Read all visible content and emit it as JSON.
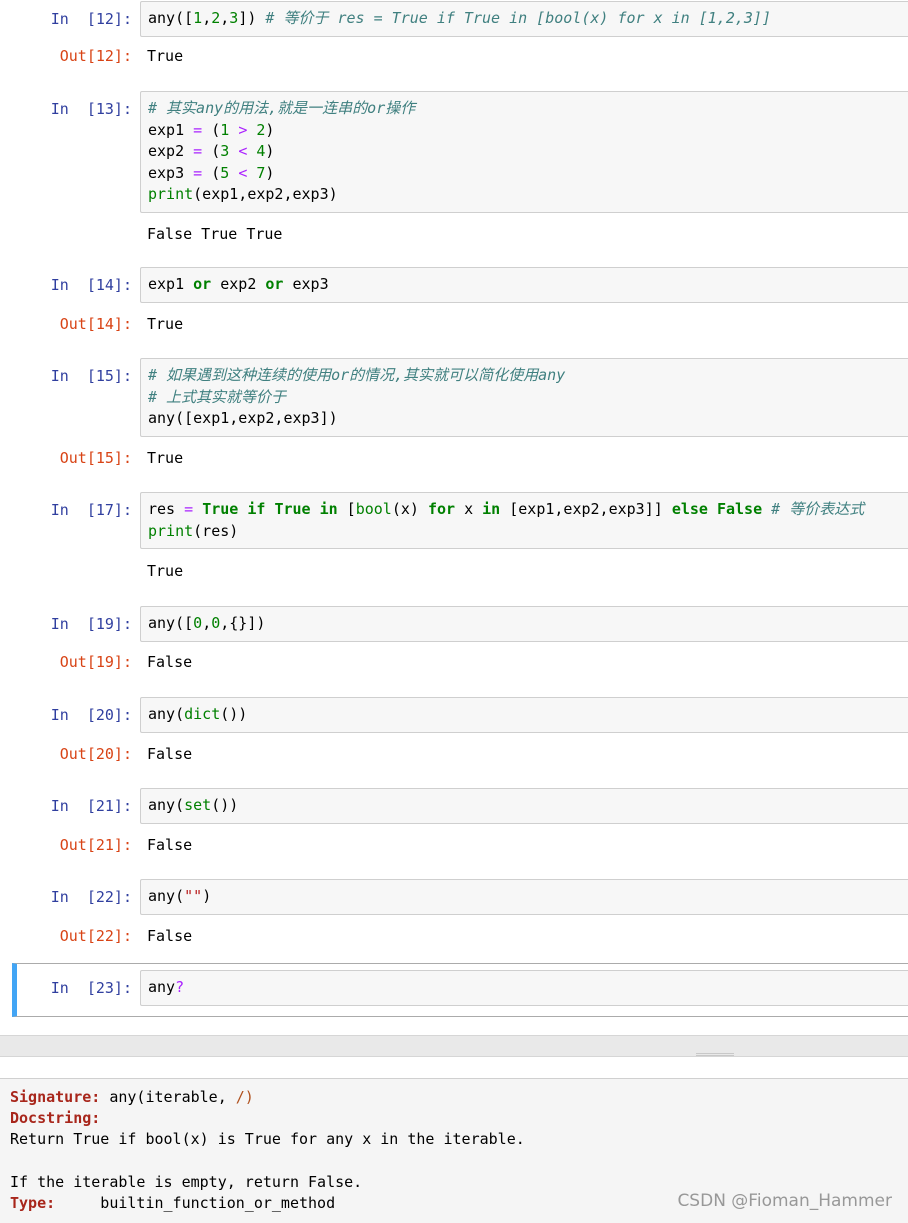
{
  "cells": [
    {
      "in_prompt": "In  [12]:",
      "code": [
        [
          [
            "nm",
            "any"
          ],
          [
            "br",
            "(["
          ],
          [
            "num",
            "1"
          ],
          [
            "nm",
            ","
          ],
          [
            "num",
            "2"
          ],
          [
            "nm",
            ","
          ],
          [
            "num",
            "3"
          ],
          [
            "br",
            "])"
          ],
          [
            "nm",
            " "
          ],
          [
            "cmt",
            "# 等价于 res = True if True in [bool(x) for x in [1,2,3]]"
          ]
        ]
      ],
      "out_prompt": "Out[12]:",
      "output": "True"
    },
    {
      "in_prompt": "In  [13]:",
      "code": [
        [
          [
            "cmt",
            "# 其实any的用法,就是一连串的or操作"
          ]
        ],
        [
          [
            "nm",
            "exp1 "
          ],
          [
            "op",
            "="
          ],
          [
            "nm",
            " ("
          ],
          [
            "num",
            "1"
          ],
          [
            "nm",
            " "
          ],
          [
            "op",
            ">"
          ],
          [
            "nm",
            " "
          ],
          [
            "num",
            "2"
          ],
          [
            "nm",
            ")"
          ]
        ],
        [
          [
            "nm",
            "exp2 "
          ],
          [
            "op",
            "="
          ],
          [
            "nm",
            " ("
          ],
          [
            "num",
            "3"
          ],
          [
            "nm",
            " "
          ],
          [
            "op",
            "<"
          ],
          [
            "nm",
            " "
          ],
          [
            "num",
            "4"
          ],
          [
            "nm",
            ")"
          ]
        ],
        [
          [
            "nm",
            "exp3 "
          ],
          [
            "op",
            "="
          ],
          [
            "nm",
            " ("
          ],
          [
            "num",
            "5"
          ],
          [
            "nm",
            " "
          ],
          [
            "op",
            "<"
          ],
          [
            "nm",
            " "
          ],
          [
            "num",
            "7"
          ],
          [
            "nm",
            ")"
          ]
        ],
        [
          [
            "bi",
            "print"
          ],
          [
            "nm",
            "(exp1,exp2,exp3)"
          ]
        ]
      ],
      "out_prompt": "",
      "output": "False True True"
    },
    {
      "in_prompt": "In  [14]:",
      "code": [
        [
          [
            "nm",
            "exp1 "
          ],
          [
            "kw",
            "or"
          ],
          [
            "nm",
            " exp2 "
          ],
          [
            "kw",
            "or"
          ],
          [
            "nm",
            " exp3"
          ]
        ]
      ],
      "out_prompt": "Out[14]:",
      "output": "True"
    },
    {
      "in_prompt": "In  [15]:",
      "code": [
        [
          [
            "cmt",
            "# 如果遇到这种连续的使用or的情况,其实就可以简化使用any"
          ]
        ],
        [
          [
            "cmt",
            "# 上式其实就等价于"
          ]
        ],
        [
          [
            "nm",
            "any([exp1,exp2,exp3])"
          ]
        ]
      ],
      "out_prompt": "Out[15]:",
      "output": "True"
    },
    {
      "in_prompt": "In  [17]:",
      "code": [
        [
          [
            "nm",
            "res "
          ],
          [
            "op",
            "="
          ],
          [
            "nm",
            " "
          ],
          [
            "kw",
            "True"
          ],
          [
            "nm",
            " "
          ],
          [
            "kw",
            "if"
          ],
          [
            "nm",
            " "
          ],
          [
            "kw",
            "True"
          ],
          [
            "nm",
            " "
          ],
          [
            "kw",
            "in"
          ],
          [
            "nm",
            " ["
          ],
          [
            "bi",
            "bool"
          ],
          [
            "nm",
            "(x) "
          ],
          [
            "kw",
            "for"
          ],
          [
            "nm",
            " x "
          ],
          [
            "kw",
            "in"
          ],
          [
            "nm",
            " [exp1,exp2,exp3]] "
          ],
          [
            "kw",
            "else"
          ],
          [
            "nm",
            " "
          ],
          [
            "kw",
            "False"
          ],
          [
            "nm",
            " "
          ],
          [
            "cmt",
            "# 等价表达式"
          ]
        ],
        [
          [
            "bi",
            "print"
          ],
          [
            "nm",
            "(res)"
          ]
        ]
      ],
      "out_prompt": "",
      "output": "True"
    },
    {
      "in_prompt": "In  [19]:",
      "code": [
        [
          [
            "nm",
            "any(["
          ],
          [
            "num",
            "0"
          ],
          [
            "nm",
            ","
          ],
          [
            "num",
            "0"
          ],
          [
            "nm",
            ",{}])"
          ]
        ]
      ],
      "out_prompt": "Out[19]:",
      "output": "False"
    },
    {
      "in_prompt": "In  [20]:",
      "code": [
        [
          [
            "nm",
            "any("
          ],
          [
            "bi",
            "dict"
          ],
          [
            "nm",
            "())"
          ]
        ]
      ],
      "out_prompt": "Out[20]:",
      "output": "False"
    },
    {
      "in_prompt": "In  [21]:",
      "code": [
        [
          [
            "nm",
            "any("
          ],
          [
            "bi",
            "set"
          ],
          [
            "nm",
            "())"
          ]
        ]
      ],
      "out_prompt": "Out[21]:",
      "output": "False"
    },
    {
      "in_prompt": "In  [22]:",
      "code": [
        [
          [
            "nm",
            "any("
          ],
          [
            "str",
            "\"\""
          ],
          [
            "nm",
            ")"
          ]
        ]
      ],
      "out_prompt": "Out[22]:",
      "output": "False"
    },
    {
      "in_prompt": "In  [23]:",
      "code": [
        [
          [
            "nm",
            "any"
          ],
          [
            "op",
            "?"
          ]
        ]
      ],
      "out_prompt": "",
      "output": "",
      "selected": true
    }
  ],
  "pager": {
    "signature_label": "Signature:",
    "signature_fn": "any(iterable, ",
    "signature_slash": "/)",
    "docstring_label": "Docstring:",
    "doc_line1": "Return True if bool(x) is True for any x in the iterable.",
    "doc_line2": "",
    "doc_line3": "If the iterable is empty, return False.",
    "type_label": "Type:",
    "type_value": "     builtin_function_or_method"
  },
  "watermark": "CSDN @Fioman_Hammer"
}
